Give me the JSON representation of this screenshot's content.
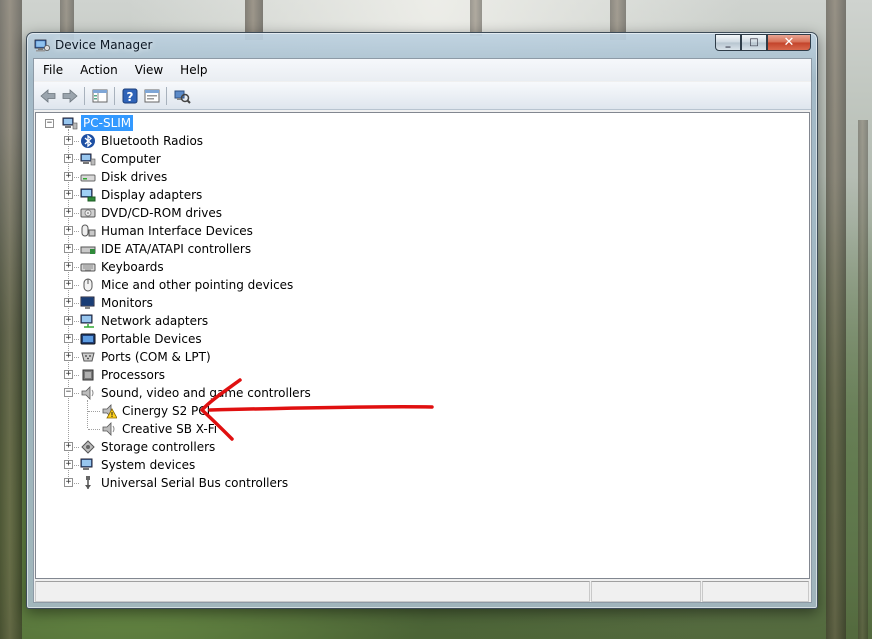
{
  "window": {
    "title": "Device Manager",
    "controls": {
      "minimize": "_",
      "maximize": "□",
      "close": "✕"
    }
  },
  "menu": {
    "items": [
      "File",
      "Action",
      "View",
      "Help"
    ]
  },
  "toolbar": {
    "buttons": [
      "back-icon",
      "forward-icon",
      "show-hide-tree-icon",
      "help-icon",
      "properties-icon",
      "scan-hardware-icon"
    ]
  },
  "tree": {
    "root": {
      "label": "PC-SLIM",
      "icon": "computer-icon",
      "selected": true
    },
    "categories": [
      {
        "label": "Bluetooth Radios",
        "icon": "bluetooth-icon",
        "expanded": false
      },
      {
        "label": "Computer",
        "icon": "computer-icon",
        "expanded": false
      },
      {
        "label": "Disk drives",
        "icon": "disk-drive-icon",
        "expanded": false
      },
      {
        "label": "Display adapters",
        "icon": "display-adapter-icon",
        "expanded": false
      },
      {
        "label": "DVD/CD-ROM drives",
        "icon": "dvd-drive-icon",
        "expanded": false
      },
      {
        "label": "Human Interface Devices",
        "icon": "hid-icon",
        "expanded": false
      },
      {
        "label": "IDE ATA/ATAPI controllers",
        "icon": "ide-controller-icon",
        "expanded": false
      },
      {
        "label": "Keyboards",
        "icon": "keyboard-icon",
        "expanded": false
      },
      {
        "label": "Mice and other pointing devices",
        "icon": "mouse-icon",
        "expanded": false
      },
      {
        "label": "Monitors",
        "icon": "monitor-icon",
        "expanded": false
      },
      {
        "label": "Network adapters",
        "icon": "network-adapter-icon",
        "expanded": false
      },
      {
        "label": "Portable Devices",
        "icon": "portable-device-icon",
        "expanded": false
      },
      {
        "label": "Ports (COM & LPT)",
        "icon": "port-icon",
        "expanded": false
      },
      {
        "label": "Processors",
        "icon": "processor-icon",
        "expanded": false
      },
      {
        "label": "Sound, video and game controllers",
        "icon": "speaker-icon",
        "expanded": true,
        "children": [
          {
            "label": "Cinergy S2 PCI",
            "icon": "speaker-warning-icon",
            "warning": true
          },
          {
            "label": "Creative SB X-Fi",
            "icon": "speaker-icon",
            "warning": false
          }
        ]
      },
      {
        "label": "Storage controllers",
        "icon": "storage-controller-icon",
        "expanded": false
      },
      {
        "label": "System devices",
        "icon": "system-device-icon",
        "expanded": false
      },
      {
        "label": "Universal Serial Bus controllers",
        "icon": "usb-icon",
        "expanded": false
      }
    ]
  },
  "expander_glyphs": {
    "collapsed": "+",
    "expanded": "−"
  },
  "annotation": {
    "color": "#e01010"
  },
  "colors": {
    "selection": "#3399ff",
    "window_frame": "#3d4b57",
    "close_button": "#c3432a"
  }
}
